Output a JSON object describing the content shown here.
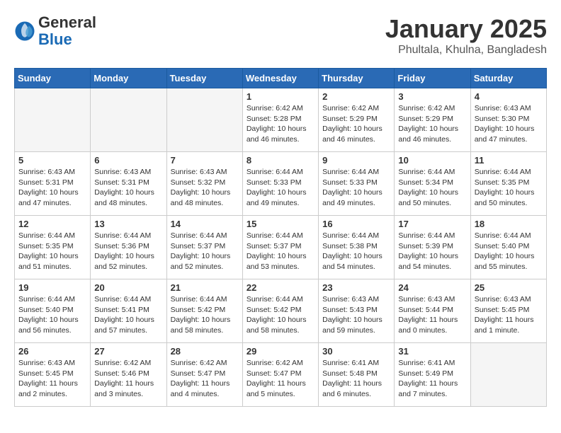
{
  "header": {
    "logo_general": "General",
    "logo_blue": "Blue",
    "month": "January 2025",
    "location": "Phultala, Khulna, Bangladesh"
  },
  "days_of_week": [
    "Sunday",
    "Monday",
    "Tuesday",
    "Wednesday",
    "Thursday",
    "Friday",
    "Saturday"
  ],
  "weeks": [
    [
      {
        "day": "",
        "empty": true
      },
      {
        "day": "",
        "empty": true
      },
      {
        "day": "",
        "empty": true
      },
      {
        "day": "1",
        "sunrise": "6:42 AM",
        "sunset": "5:28 PM",
        "daylight": "10 hours and 46 minutes."
      },
      {
        "day": "2",
        "sunrise": "6:42 AM",
        "sunset": "5:29 PM",
        "daylight": "10 hours and 46 minutes."
      },
      {
        "day": "3",
        "sunrise": "6:42 AM",
        "sunset": "5:29 PM",
        "daylight": "10 hours and 46 minutes."
      },
      {
        "day": "4",
        "sunrise": "6:43 AM",
        "sunset": "5:30 PM",
        "daylight": "10 hours and 47 minutes."
      }
    ],
    [
      {
        "day": "5",
        "sunrise": "6:43 AM",
        "sunset": "5:31 PM",
        "daylight": "10 hours and 47 minutes."
      },
      {
        "day": "6",
        "sunrise": "6:43 AM",
        "sunset": "5:31 PM",
        "daylight": "10 hours and 48 minutes."
      },
      {
        "day": "7",
        "sunrise": "6:43 AM",
        "sunset": "5:32 PM",
        "daylight": "10 hours and 48 minutes."
      },
      {
        "day": "8",
        "sunrise": "6:44 AM",
        "sunset": "5:33 PM",
        "daylight": "10 hours and 49 minutes."
      },
      {
        "day": "9",
        "sunrise": "6:44 AM",
        "sunset": "5:33 PM",
        "daylight": "10 hours and 49 minutes."
      },
      {
        "day": "10",
        "sunrise": "6:44 AM",
        "sunset": "5:34 PM",
        "daylight": "10 hours and 50 minutes."
      },
      {
        "day": "11",
        "sunrise": "6:44 AM",
        "sunset": "5:35 PM",
        "daylight": "10 hours and 50 minutes."
      }
    ],
    [
      {
        "day": "12",
        "sunrise": "6:44 AM",
        "sunset": "5:35 PM",
        "daylight": "10 hours and 51 minutes."
      },
      {
        "day": "13",
        "sunrise": "6:44 AM",
        "sunset": "5:36 PM",
        "daylight": "10 hours and 52 minutes."
      },
      {
        "day": "14",
        "sunrise": "6:44 AM",
        "sunset": "5:37 PM",
        "daylight": "10 hours and 52 minutes."
      },
      {
        "day": "15",
        "sunrise": "6:44 AM",
        "sunset": "5:37 PM",
        "daylight": "10 hours and 53 minutes."
      },
      {
        "day": "16",
        "sunrise": "6:44 AM",
        "sunset": "5:38 PM",
        "daylight": "10 hours and 54 minutes."
      },
      {
        "day": "17",
        "sunrise": "6:44 AM",
        "sunset": "5:39 PM",
        "daylight": "10 hours and 54 minutes."
      },
      {
        "day": "18",
        "sunrise": "6:44 AM",
        "sunset": "5:40 PM",
        "daylight": "10 hours and 55 minutes."
      }
    ],
    [
      {
        "day": "19",
        "sunrise": "6:44 AM",
        "sunset": "5:40 PM",
        "daylight": "10 hours and 56 minutes."
      },
      {
        "day": "20",
        "sunrise": "6:44 AM",
        "sunset": "5:41 PM",
        "daylight": "10 hours and 57 minutes."
      },
      {
        "day": "21",
        "sunrise": "6:44 AM",
        "sunset": "5:42 PM",
        "daylight": "10 hours and 58 minutes."
      },
      {
        "day": "22",
        "sunrise": "6:44 AM",
        "sunset": "5:42 PM",
        "daylight": "10 hours and 58 minutes."
      },
      {
        "day": "23",
        "sunrise": "6:43 AM",
        "sunset": "5:43 PM",
        "daylight": "10 hours and 59 minutes."
      },
      {
        "day": "24",
        "sunrise": "6:43 AM",
        "sunset": "5:44 PM",
        "daylight": "11 hours and 0 minutes."
      },
      {
        "day": "25",
        "sunrise": "6:43 AM",
        "sunset": "5:45 PM",
        "daylight": "11 hours and 1 minute."
      }
    ],
    [
      {
        "day": "26",
        "sunrise": "6:43 AM",
        "sunset": "5:45 PM",
        "daylight": "11 hours and 2 minutes."
      },
      {
        "day": "27",
        "sunrise": "6:42 AM",
        "sunset": "5:46 PM",
        "daylight": "11 hours and 3 minutes."
      },
      {
        "day": "28",
        "sunrise": "6:42 AM",
        "sunset": "5:47 PM",
        "daylight": "11 hours and 4 minutes."
      },
      {
        "day": "29",
        "sunrise": "6:42 AM",
        "sunset": "5:47 PM",
        "daylight": "11 hours and 5 minutes."
      },
      {
        "day": "30",
        "sunrise": "6:41 AM",
        "sunset": "5:48 PM",
        "daylight": "11 hours and 6 minutes."
      },
      {
        "day": "31",
        "sunrise": "6:41 AM",
        "sunset": "5:49 PM",
        "daylight": "11 hours and 7 minutes."
      },
      {
        "day": "",
        "empty": true
      }
    ]
  ]
}
